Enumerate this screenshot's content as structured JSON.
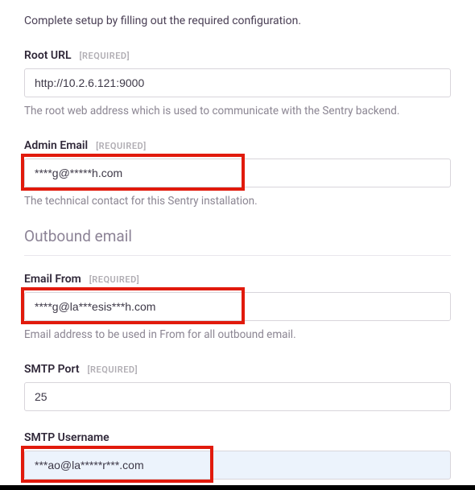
{
  "intro": "Complete setup by filling out the required configuration.",
  "required_badge": "[REQUIRED]",
  "fields": {
    "root_url": {
      "label": "Root URL",
      "value": "http://10.2.6.121:9000",
      "help": "The root web address which is used to communicate with the Sentry backend."
    },
    "admin_email": {
      "label": "Admin Email",
      "value": "****g@*****h.com",
      "help": "The technical contact for this Sentry installation."
    },
    "email_from": {
      "label": "Email From",
      "value": "****g@la***esis***h.com",
      "help": "Email address to be used in From for all outbound email."
    },
    "smtp_port": {
      "label": "SMTP Port",
      "value": "25"
    },
    "smtp_username": {
      "label": "SMTP Username",
      "value": "***ao@la*****r***.com"
    }
  },
  "sections": {
    "outbound_email": "Outbound email"
  }
}
